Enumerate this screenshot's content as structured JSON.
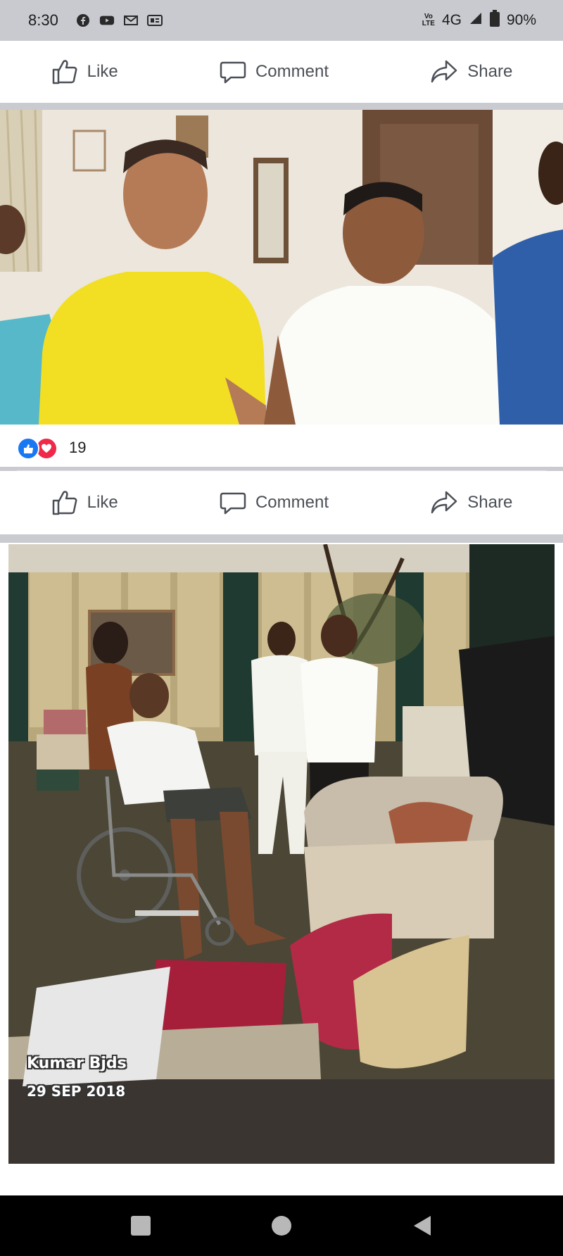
{
  "status_bar": {
    "time": "8:30",
    "network_type": "4G",
    "volte": "Vo\nLTE",
    "battery": "90%",
    "icons": [
      "facebook-icon",
      "youtube-icon",
      "gmail-icon",
      "message-icon"
    ]
  },
  "actions_top": {
    "like": "Like",
    "comment": "Comment",
    "share": "Share"
  },
  "post1": {
    "reaction_count": "19",
    "actions": {
      "like": "Like",
      "comment": "Comment",
      "share": "Share"
    }
  },
  "post2": {
    "watermark_name": "Kumar Bjds",
    "watermark_date": "29 SEP 2018"
  },
  "colors": {
    "facebook_blue": "#1877f2",
    "love_red": "#f02849",
    "action_gray": "#4b4f56"
  },
  "nav": [
    "recents-icon",
    "home-icon",
    "back-icon"
  ]
}
